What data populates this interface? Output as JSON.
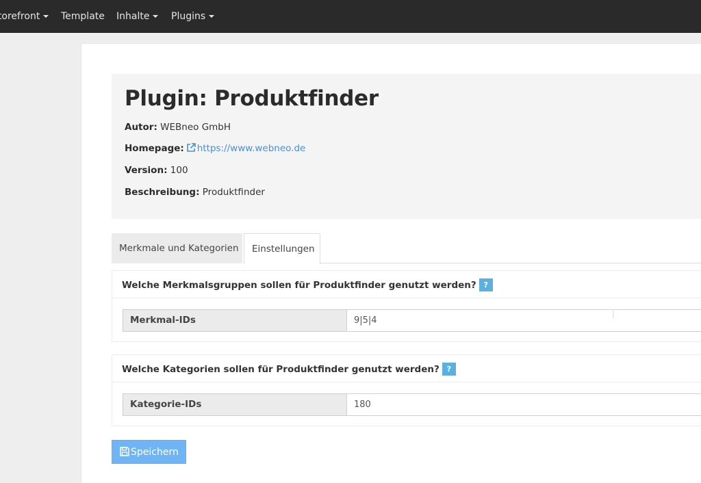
{
  "navbar": {
    "items": [
      {
        "label": "Storefront",
        "has_dropdown": true
      },
      {
        "label": "Template",
        "has_dropdown": false
      },
      {
        "label": "Inhalte",
        "has_dropdown": true
      },
      {
        "label": "Plugins",
        "has_dropdown": true
      }
    ]
  },
  "plugin": {
    "title": "Plugin: Produktfinder",
    "author_label": "Autor:",
    "author_value": "WEBneo GmbH",
    "homepage_label": "Homepage:",
    "homepage_icon": "external-link-icon",
    "homepage_url": "https://www.webneo.de",
    "version_label": "Version:",
    "version_value": "100",
    "description_label": "Beschreibung:",
    "description_value": "Produktfinder"
  },
  "tabs": [
    {
      "label": "Merkmale und Kategorien",
      "active": false
    },
    {
      "label": "Einstellungen",
      "active": true
    }
  ],
  "settings": [
    {
      "question": "Welche Merkmalsgruppen sollen für Produktfinder genutzt werden?",
      "help_icon": "?",
      "field_label": "Merkmal-IDs",
      "field_value": "9|5|4"
    },
    {
      "question": "Welche Kategorien sollen für Produktfinder genutzt werden?",
      "help_icon": "?",
      "field_label": "Kategorie-IDs",
      "field_value": "180"
    }
  ],
  "actions": {
    "save_label": "Speichern",
    "save_icon": "floppy-disk-icon"
  },
  "colors": {
    "navbar_bg": "#2a2a2a",
    "link": "#4a8fd6",
    "help_badge": "#5bb0de",
    "save_button": "#6fb5f5"
  }
}
